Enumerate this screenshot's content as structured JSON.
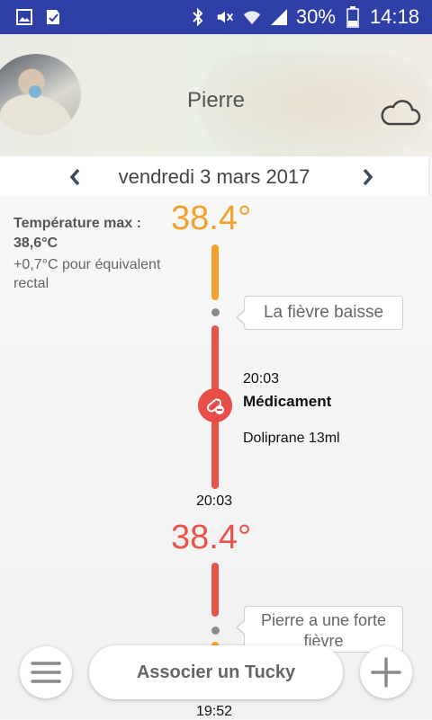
{
  "status_bar": {
    "battery": "30%",
    "time": "14:18",
    "icons": [
      "gallery-icon",
      "task-icon",
      "bluetooth-icon",
      "mute-icon",
      "wifi-icon",
      "signal-icon",
      "battery-icon"
    ]
  },
  "header": {
    "child_name": "Pierre",
    "weather_icon": "cloud-icon"
  },
  "date_nav": {
    "date": "vendredi 3 mars 2017"
  },
  "summary": {
    "max_label": "Température max : 38,6°C",
    "rectal_note": "+0,7°C pour équivalent rectal"
  },
  "timeline": {
    "reading1": "38.4°",
    "callout1": "La fièvre baisse",
    "med_time": "20:03",
    "med_title": "Médicament",
    "med_name": "Doliprane 13ml",
    "time_below": "20:03",
    "reading2": "38.4°",
    "callout2": "Pierre a une forte fièvre",
    "time_bottom": "19:52"
  },
  "bottom_bar": {
    "associate_label": "Associer un Tucky"
  },
  "colors": {
    "status_bar": "#2f3fa8",
    "orange": "#f4a12c",
    "red": "#e8534b"
  }
}
